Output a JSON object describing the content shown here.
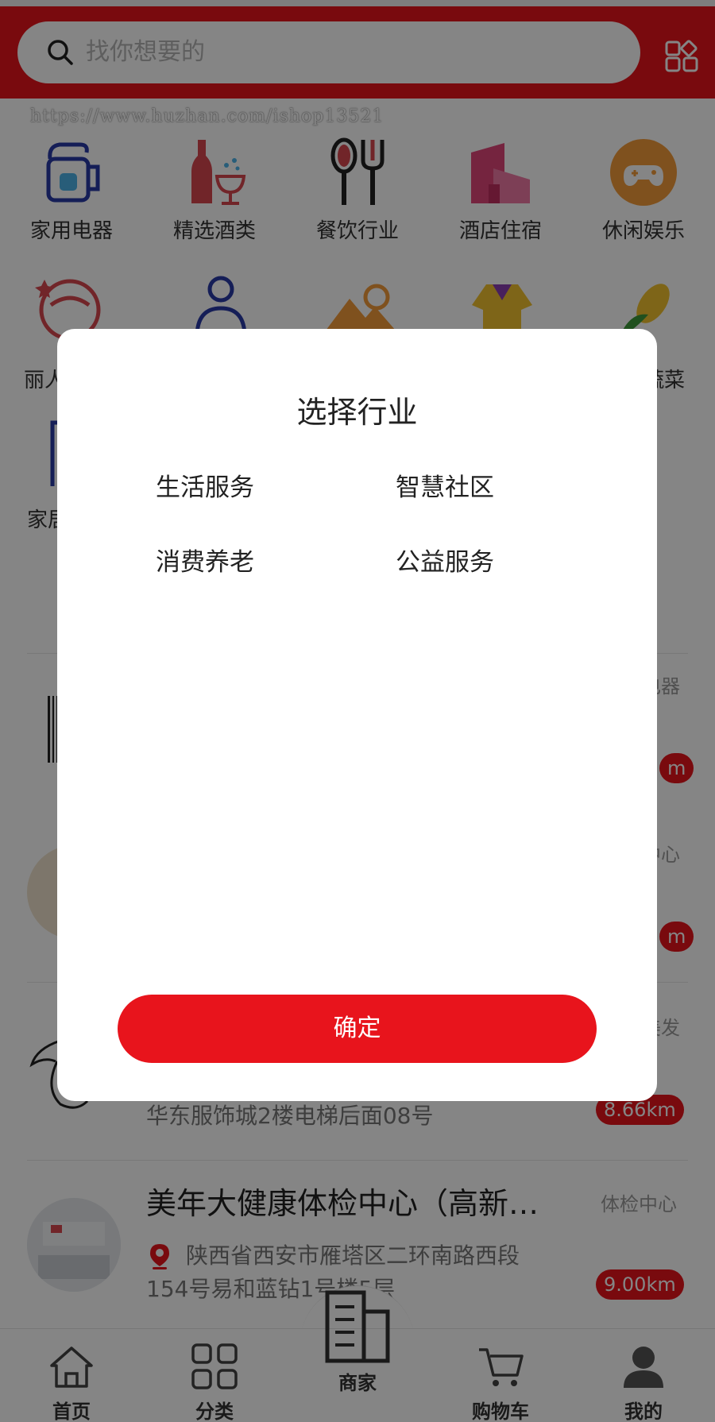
{
  "header": {
    "search_placeholder": "找你想要的",
    "watermark": "https://www.huzhan.com/ishop13521"
  },
  "categories": [
    {
      "label": "家用电器",
      "icon": "kettle-icon"
    },
    {
      "label": "精选酒类",
      "icon": "wine-icon"
    },
    {
      "label": "餐饮行业",
      "icon": "fork-spoon-icon"
    },
    {
      "label": "酒店住宿",
      "icon": "hotel-icon"
    },
    {
      "label": "休闲娱乐",
      "icon": "gamepad-icon"
    }
  ],
  "categories_row2_visible": {
    "left": "丽人",
    "right": "蔬菜"
  },
  "categories_row3_visible": {
    "left": "家居"
  },
  "shops": [
    {
      "category_partial": "电器",
      "distance_partial": "m"
    },
    {
      "category_partial": "中心",
      "distance_partial": "m"
    },
    {
      "category_partial": "美发",
      "address": "华东服饰城2楼电梯后面08号",
      "distance": "8.66km"
    },
    {
      "name": "美年大健康体检中心（高新…",
      "category": "体检中心",
      "address": "陕西省西安市雁塔区二环南路西段154号易和蓝钻1号楼5层",
      "distance": "9.00km"
    }
  ],
  "tabs": [
    {
      "label": "首页",
      "icon": "home-icon"
    },
    {
      "label": "分类",
      "icon": "grid-icon"
    },
    {
      "label": "商家",
      "icon": "building-icon"
    },
    {
      "label": "购物车",
      "icon": "cart-icon"
    },
    {
      "label": "我的",
      "icon": "user-icon"
    }
  ],
  "modal": {
    "title": "选择行业",
    "options": [
      "生活服务",
      "智慧社区",
      "消费养老",
      "公益服务"
    ],
    "confirm_label": "确定"
  },
  "colors": {
    "accent": "#e8141c",
    "overlay": "rgba(0,0,0,0.48)"
  }
}
